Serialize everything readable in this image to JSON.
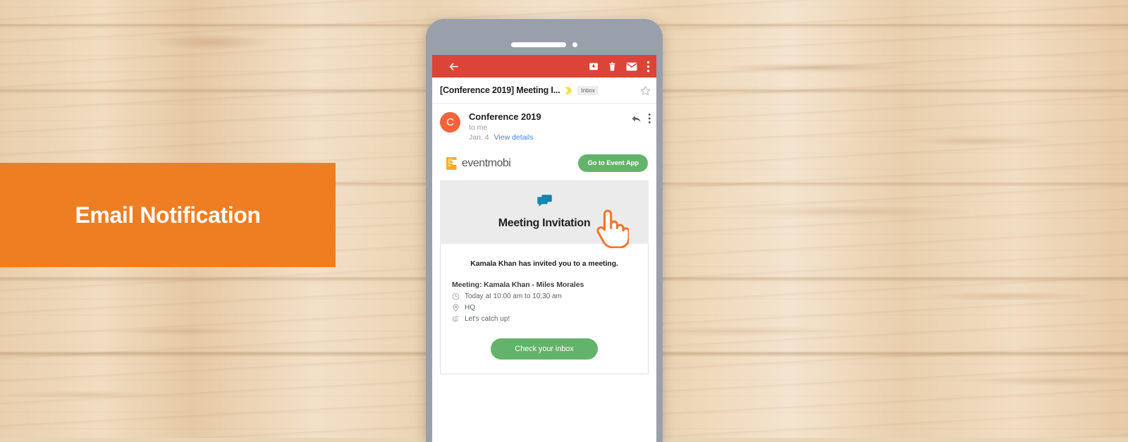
{
  "banner": {
    "label": "Email Notification",
    "background": "#ef7e23",
    "text_color": "#ffffff"
  },
  "phone": {
    "frame_color": "#9aa0ab",
    "screen_background": "#ffffff"
  },
  "gmail": {
    "toolbar": {
      "background": "#db4437",
      "back_label": "Back",
      "archive_label": "Archive",
      "delete_label": "Delete",
      "mark_unread_label": "Mark as unread",
      "more_label": "More options"
    },
    "subject": {
      "text": "[Conference 2019] Meeting I...",
      "label_chip": "Inbox",
      "starred": false,
      "importance_marker_color": "#f4e04d"
    },
    "sender": {
      "avatar_initial": "C",
      "avatar_color": "#f4633a",
      "name": "Conference 2019",
      "recipient": "to me",
      "date": "Jan. 4",
      "details_link": "View details",
      "details_link_color": "#4285f4",
      "reply_label": "Reply",
      "more_label": "More options"
    }
  },
  "email": {
    "brand": {
      "logo_text": "eventmobi",
      "logo_mark_color": "#f9a826",
      "cta_label": "Go to Event App",
      "cta_color": "#64b36a"
    },
    "invitation": {
      "icon_name": "chat-bubbles-icon",
      "icon_color": "#1a81a8",
      "heading": "Meeting Invitation",
      "lead": "Kamala Khan has invited you to a meeting.",
      "meeting_title": "Meeting: Kamala Khan - Miles Morales",
      "details": [
        {
          "icon": "clock-icon",
          "text": "Today at 10:00 am to 10:30 am"
        },
        {
          "icon": "location-pin-icon",
          "text": "HQ"
        },
        {
          "icon": "description-icon",
          "text": "Let's catch up!"
        }
      ],
      "cta_label": "Check your inbox",
      "cta_color": "#64b36a"
    }
  },
  "cursor": {
    "name": "pointing-hand-cursor",
    "color": "#f4762a"
  }
}
